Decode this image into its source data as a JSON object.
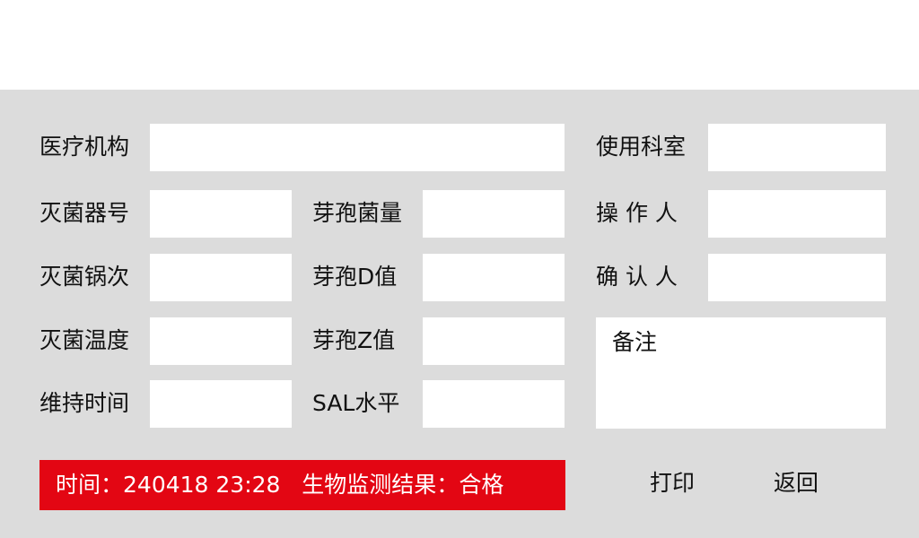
{
  "form": {
    "institution_label": "医疗机构",
    "department_label": "使用科室",
    "sterilizer_no_label": "灭菌器号",
    "spore_count_label": "芽孢菌量",
    "operator_label": "操 作 人",
    "batch_label": "灭菌锅次",
    "spore_d_label": "芽孢D值",
    "confirmer_label": "确 认 人",
    "temperature_label": "灭菌温度",
    "spore_z_label": "芽孢Z值",
    "remarks_label": "备注",
    "hold_time_label": "维持时间",
    "sal_label": "SAL水平"
  },
  "status": {
    "time_label": "时间：",
    "time_value": "240418 23:28",
    "result_label": "生物监测结果：",
    "result_value": "合格"
  },
  "buttons": {
    "print": "打印",
    "back": "返回"
  },
  "colors": {
    "panel_bg": "#dcdcdc",
    "status_bg": "#e30613"
  }
}
